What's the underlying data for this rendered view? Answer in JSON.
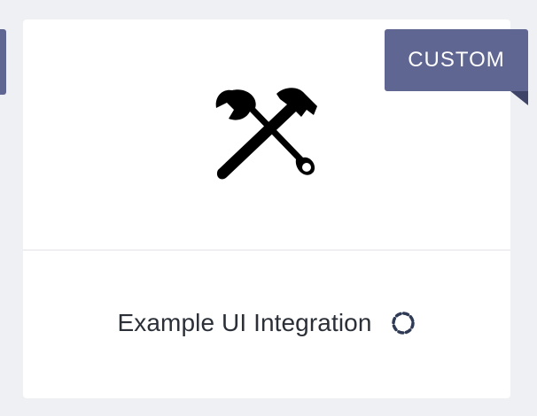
{
  "card": {
    "title": "Example UI Integration",
    "badge": "CUSTOM",
    "icon": "tools-icon",
    "status_icon": "loading-spinner-icon"
  },
  "colors": {
    "background": "#eff0f3",
    "card": "#ffffff",
    "badge": "#5f6691",
    "badge_fold": "#3e4468",
    "title_text": "#2b2f38",
    "divider": "#e2e3e8"
  }
}
